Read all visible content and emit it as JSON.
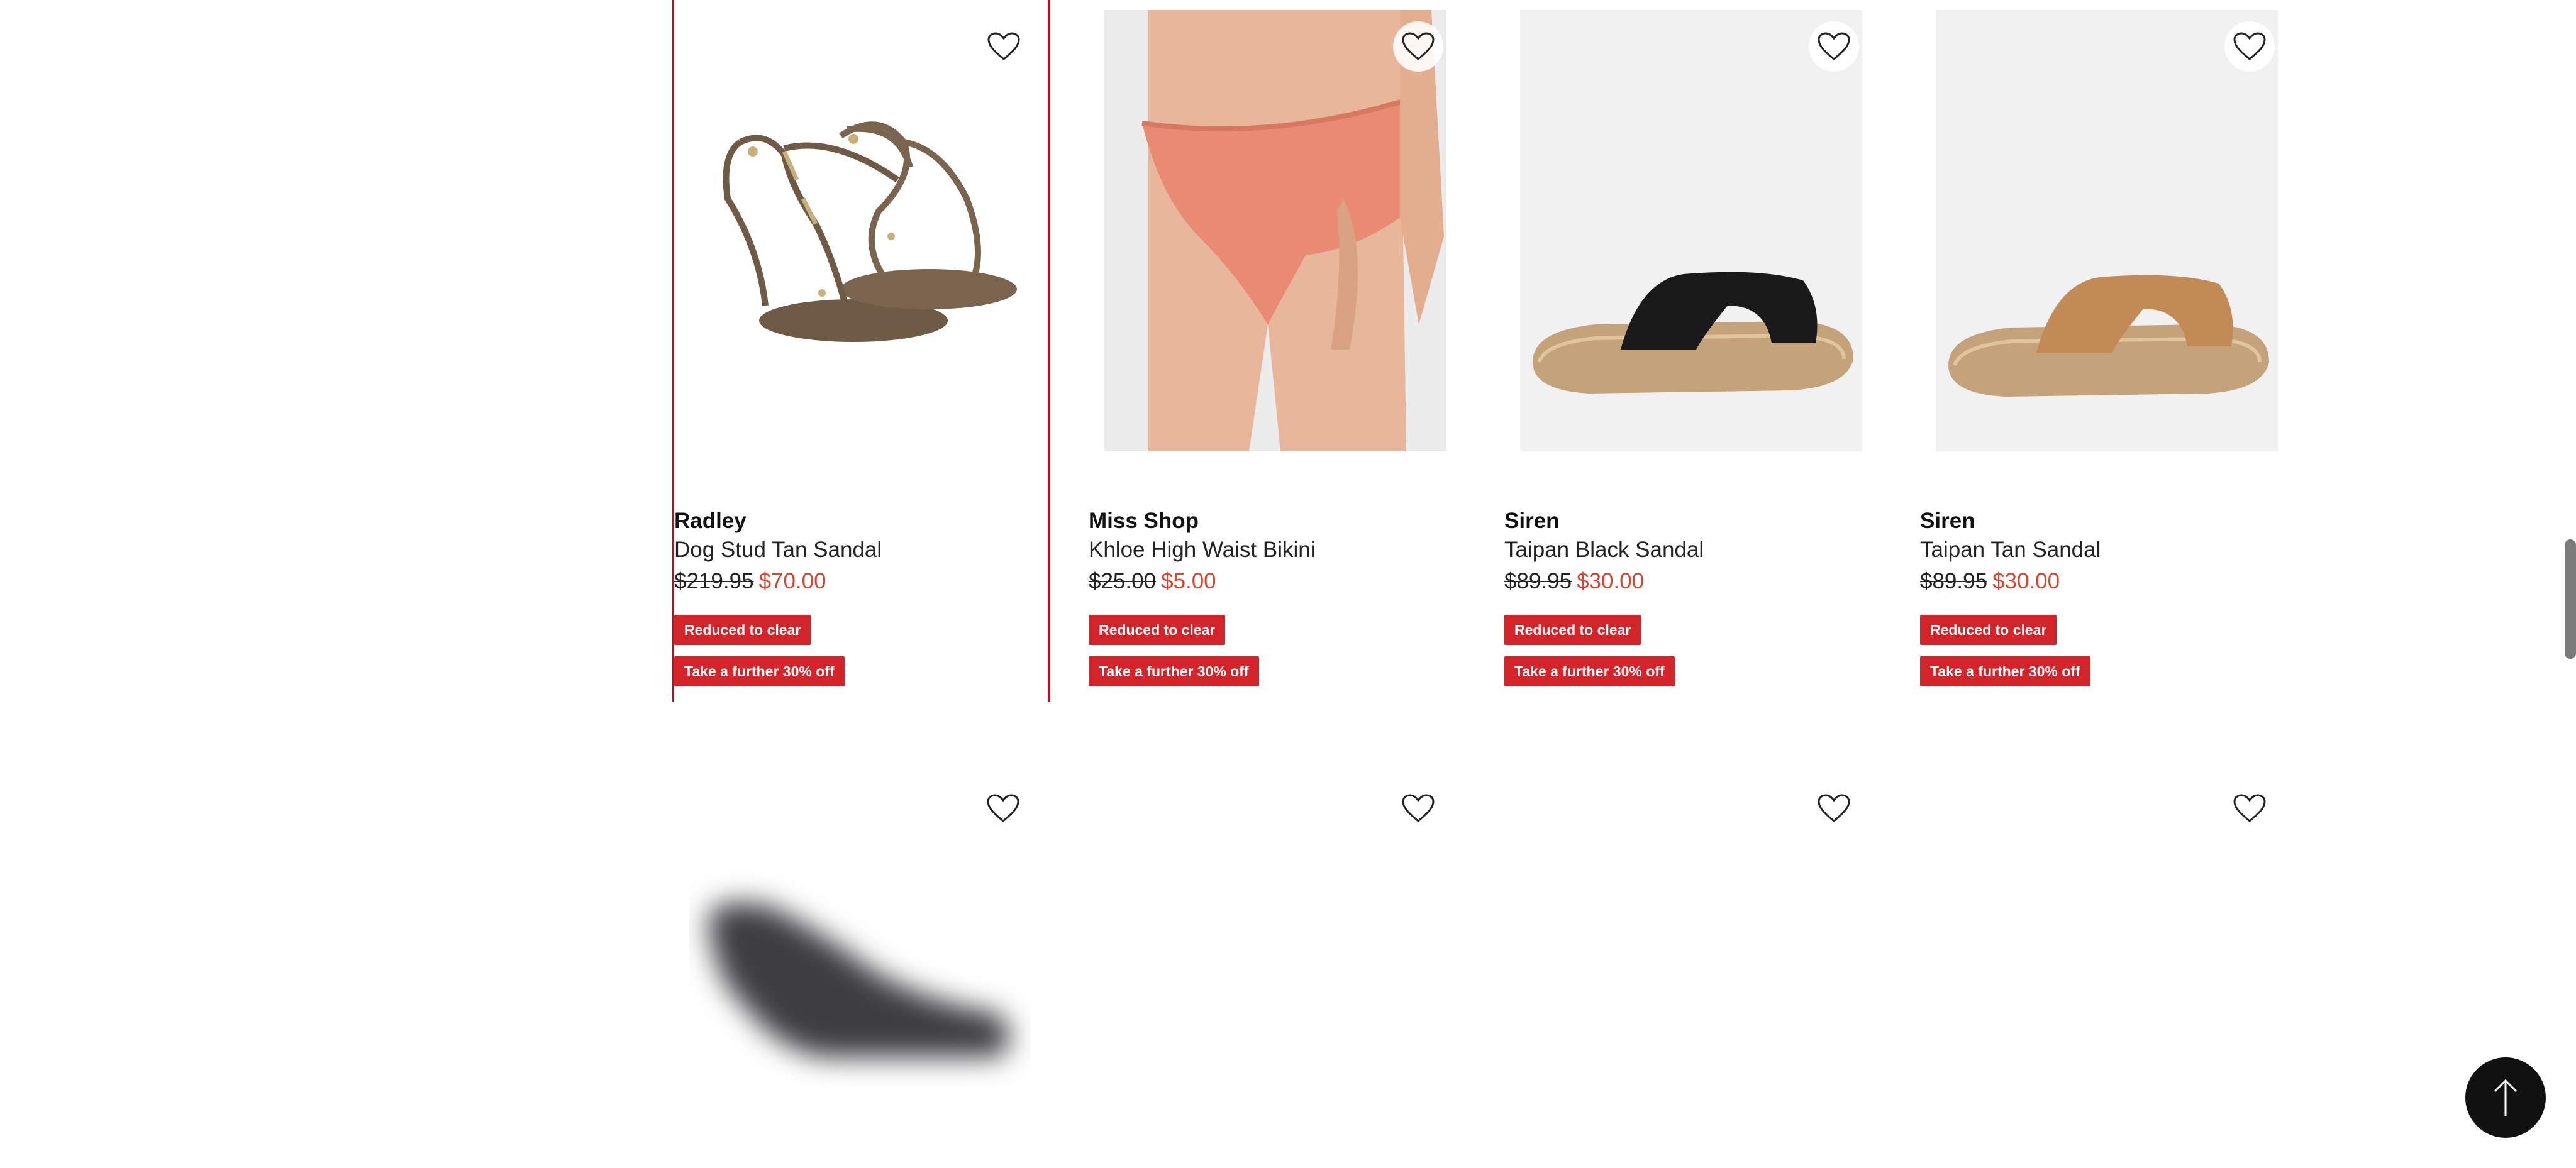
{
  "products": [
    {
      "brand": "Radley",
      "name": "Dog Stud Tan Sandal",
      "was_price": "$219.95",
      "now_price": "$70.00",
      "badges": [
        "Reduced to clear",
        "Take a further 30% off"
      ],
      "image": "tan-strappy-sandal",
      "selected": true
    },
    {
      "brand": "Miss Shop",
      "name": "Khloe High Waist Bikini",
      "was_price": "$25.00",
      "now_price": "$5.00",
      "badges": [
        "Reduced to clear",
        "Take a further 30% off"
      ],
      "image": "coral-bikini-bottom"
    },
    {
      "brand": "Siren",
      "name": "Taipan Black Sandal",
      "was_price": "$89.95",
      "now_price": "$30.00",
      "badges": [
        "Reduced to clear",
        "Take a further 30% off"
      ],
      "image": "black-slide-sandal"
    },
    {
      "brand": "Siren",
      "name": "Taipan Tan Sandal",
      "was_price": "$89.95",
      "now_price": "$30.00",
      "badges": [
        "Reduced to clear",
        "Take a further 30% off"
      ],
      "image": "tan-slide-sandal"
    }
  ],
  "row2": [
    {
      "image": "blurred-black-heel-loading"
    },
    {
      "image": "empty-loading"
    },
    {
      "image": "empty-loading"
    },
    {
      "image": "empty-loading"
    }
  ],
  "icons": {
    "wishlist": "heart-outline-icon",
    "back_to_top": "arrow-up-icon"
  },
  "colors": {
    "badge": "#d3242a",
    "sale_price": "#d6452d",
    "selected_border": "#d6001c"
  }
}
